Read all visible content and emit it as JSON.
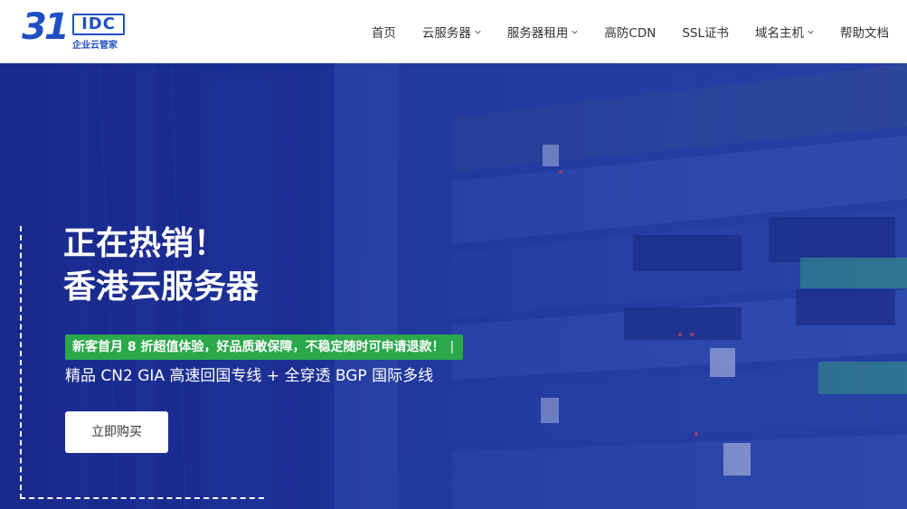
{
  "header": {
    "logo": {
      "number": "31",
      "box_text": "IDC",
      "subtitle": "企业云管家"
    },
    "nav": [
      {
        "label": "首页",
        "has_dropdown": false
      },
      {
        "label": "云服务器",
        "has_dropdown": true
      },
      {
        "label": "服务器租用",
        "has_dropdown": true
      },
      {
        "label": "高防CDN",
        "has_dropdown": false
      },
      {
        "label": "SSL证书",
        "has_dropdown": false
      },
      {
        "label": "域名主机",
        "has_dropdown": true
      },
      {
        "label": "帮助文档",
        "has_dropdown": false
      }
    ]
  },
  "hero": {
    "title_line1": "正在热销！",
    "title_line2": "香港云服务器",
    "promo_text": "新客首月 8 折超值体验，好品质敢保障，不稳定随时可申请退款！",
    "promo_cursor": "|",
    "subline": "精品 CN2 GIA 高速回国专线 + 全穿透 BGP 国际多线",
    "buy_button": "立即购买"
  },
  "colors": {
    "brand_blue": "#1f4fc4",
    "hero_blue": "#213a9e",
    "promo_green": "#2aa84a",
    "nav_text": "#333333"
  },
  "icons": {
    "nav_dropdown": "chevron-down-icon",
    "hero_background": "server-rack-image"
  }
}
